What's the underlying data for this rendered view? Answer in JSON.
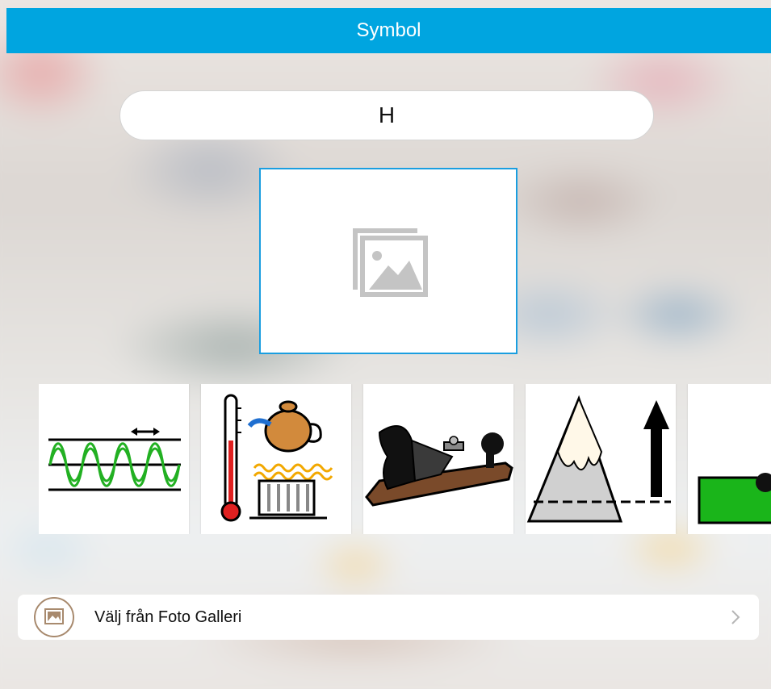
{
  "header": {
    "title": "Symbol"
  },
  "name_field": {
    "value": "H"
  },
  "preview": {
    "icon": "image-placeholder-icon"
  },
  "symbols": [
    {
      "name": "frequency-symbol",
      "icon": "wave-icon"
    },
    {
      "name": "heat-symbol",
      "icon": "thermometer-teapot-radiator-icon"
    },
    {
      "name": "plane-tool-symbol",
      "icon": "hand-plane-icon"
    },
    {
      "name": "height-symbol",
      "icon": "mountain-arrow-icon"
    },
    {
      "name": "level-symbol",
      "icon": "green-level-icon"
    }
  ],
  "gallery": {
    "label": "Välj från Foto Galleri",
    "icon": "photo-gallery-icon",
    "chevron": "chevron-right-icon"
  },
  "colors": {
    "accent": "#00a5e0",
    "preview_border": "#1a9ee0",
    "gallery_icon": "#a88a6e"
  }
}
